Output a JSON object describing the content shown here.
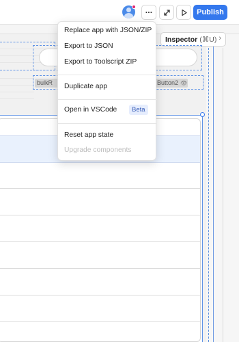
{
  "toolbar": {
    "more_label": "···",
    "publish_label": "Publish",
    "inspector_label": "Inspector",
    "inspector_shortcut": "(⌘U)",
    "chevron": "›"
  },
  "canvas": {
    "chip_left": "bulkR",
    "chip_right": "Button2",
    "chip_right_icon": "👁"
  },
  "menu": {
    "items": [
      {
        "label": "Replace app with JSON/ZIP",
        "disabled": false
      },
      {
        "label": "Export to JSON",
        "disabled": false
      },
      {
        "label": "Export to Toolscript ZIP",
        "disabled": false
      },
      {
        "label": "Duplicate app",
        "disabled": false
      },
      {
        "label": "Open in VSCode",
        "disabled": false,
        "badge": "Beta"
      },
      {
        "label": "Reset app state",
        "disabled": false
      },
      {
        "label": "Upgrade components",
        "disabled": true
      }
    ]
  },
  "colors": {
    "accent": "#3478ed",
    "selection_dashed": "#5f93e6",
    "notification_dot": "#e0246f",
    "beta_badge_bg": "#e6edfd"
  },
  "icons": [
    "user-avatar-icon",
    "more-icon",
    "expand-icon",
    "play-icon",
    "chevron-right-icon",
    "eye-icon"
  ]
}
